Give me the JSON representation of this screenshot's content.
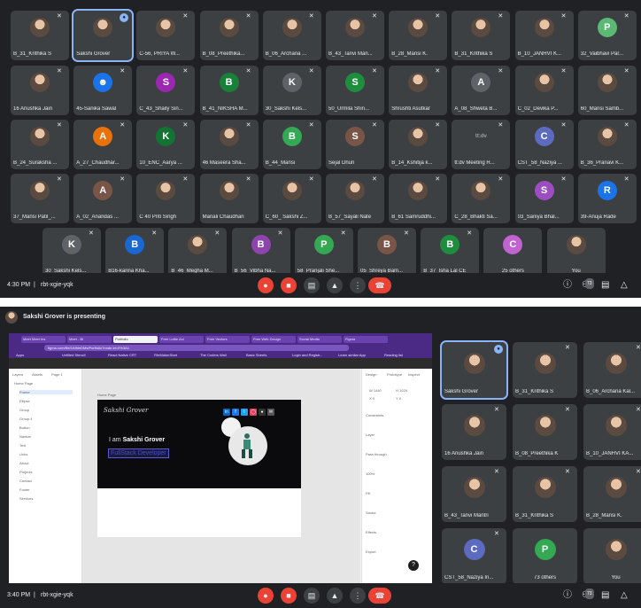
{
  "grid": {
    "tiles": [
      {
        "name": "B_31_Krithika S",
        "initial": "",
        "color": "#7b1f2e",
        "photo": true
      },
      {
        "name": "Sakshi Grover",
        "initial": "",
        "color": "#b08868",
        "photo": true
      },
      {
        "name": "C-56, PRIYA W...",
        "initial": "",
        "color": "#d9cbb8",
        "photo": true
      },
      {
        "name": "B_08_Preethika...",
        "initial": "",
        "color": "#cccccc",
        "photo": true
      },
      {
        "name": "B_06_Archana ...",
        "initial": "",
        "color": "#1a1a1a",
        "photo": true
      },
      {
        "name": "B_43_Tanvi Man...",
        "initial": "",
        "color": "#c48a6a",
        "photo": true
      },
      {
        "name": "B_28_Mansi K.",
        "initial": "",
        "color": "#7a5038",
        "photo": true
      },
      {
        "name": "B_31_Krithika S",
        "initial": "",
        "color": "#7b1f2e",
        "photo": true
      },
      {
        "name": "B_10_JANHVI K...",
        "initial": "",
        "color": "#6a5040",
        "photo": true
      },
      {
        "name": "32_Vaibhavi Par...",
        "initial": "P",
        "color": "#5bb974",
        "photo": false
      },
      {
        "name": "16 Anushka Jain",
        "initial": "",
        "color": "#6a4636",
        "photo": true
      },
      {
        "name": "45-Sanika Sawal",
        "initial": "☻",
        "color": "#1a73e8",
        "photo": false
      },
      {
        "name": "C_43_Shaily Sin...",
        "initial": "S",
        "color": "#9c27b0",
        "photo": false
      },
      {
        "name": "B_41_NIKSHA M...",
        "initial": "B",
        "color": "#188038",
        "photo": false
      },
      {
        "name": "30_Sakshi Kels...",
        "initial": "K",
        "color": "#5f6368",
        "photo": false
      },
      {
        "name": "50_Urmila Shin...",
        "initial": "S",
        "color": "#1e8e3e",
        "photo": false
      },
      {
        "name": "Shrushti Asutkar",
        "initial": "",
        "color": "#c0502a",
        "photo": true
      },
      {
        "name": "A_08_Shweta B...",
        "initial": "A",
        "color": "#5f6368",
        "photo": false
      },
      {
        "name": "C_02_Devika P...",
        "initial": "",
        "color": "#a07050",
        "photo": true
      },
      {
        "name": "60_Mansi Samb...",
        "initial": "",
        "color": "#8a4050",
        "photo": true
      },
      {
        "name": "B_24_Suraksha ...",
        "initial": "",
        "color": "#403a36",
        "photo": true
      },
      {
        "name": "A_27_Chaudhar...",
        "initial": "A",
        "color": "#e8710a",
        "photo": false
      },
      {
        "name": "10_ENC_Aarya ...",
        "initial": "K",
        "color": "#137333",
        "photo": false
      },
      {
        "name": "46 Maseera Sha...",
        "initial": "",
        "color": "#8a6a5a",
        "photo": true
      },
      {
        "name": "B_44_Mansi",
        "initial": "B",
        "color": "#34a853",
        "photo": false
      },
      {
        "name": "Sejal Dhuri",
        "initial": "S",
        "color": "#795548",
        "photo": false
      },
      {
        "name": "B_14_Kshitija k...",
        "initial": "",
        "color": "#c08a20",
        "photo": true
      },
      {
        "name": "tt:dv Meeting R...",
        "initial": "tt:dv",
        "color": "#3c4043",
        "photo": false
      },
      {
        "name": "CST_58_Naziya ...",
        "initial": "C",
        "color": "#5c6bc0",
        "photo": false
      },
      {
        "name": "B_36_Pranavi K...",
        "initial": "",
        "color": "#8a8a50",
        "photo": true
      },
      {
        "name": "37_Mansi Patil_...",
        "initial": "",
        "color": "#2040a0",
        "photo": true
      },
      {
        "name": "A_02_Anandas ...",
        "initial": "A",
        "color": "#795548",
        "photo": false
      },
      {
        "name": "C 40 Priti Singh",
        "initial": "",
        "color": "#7a5040",
        "photo": true
      },
      {
        "name": "Manali Chaudhari",
        "initial": "",
        "color": "#c09a70",
        "photo": true
      },
      {
        "name": "C_60_ Sakshi Z...",
        "initial": "",
        "color": "#9a8a7a",
        "photo": true
      },
      {
        "name": "B_57_Sayali Nate",
        "initial": "",
        "color": "#e0e0e0",
        "photo": true
      },
      {
        "name": "B_61 Samruddhi...",
        "initial": "",
        "color": "#b07a5a",
        "photo": true
      },
      {
        "name": "C_28_Bhakti Sa...",
        "initial": "",
        "color": "#a06a50",
        "photo": true
      },
      {
        "name": "03_Saniya Bhal...",
        "initial": "S",
        "color": "#9c4ec0",
        "photo": false
      },
      {
        "name": "39-Anuja Rade",
        "initial": "R",
        "color": "#1a73e8",
        "photo": false
      },
      {
        "name": "30_Sakshi Kels...",
        "initial": "K",
        "color": "#5f6368",
        "photo": false
      },
      {
        "name": "B16-karina Kha...",
        "initial": "B",
        "color": "#1967d2",
        "photo": false
      },
      {
        "name": "B_46_Megha M...",
        "initial": "",
        "color": "#9a8070",
        "photo": true
      },
      {
        "name": "B_56_Vibha Na...",
        "initial": "B",
        "color": "#8e44ad",
        "photo": false
      },
      {
        "name": "58_Pranjali She...",
        "initial": "P",
        "color": "#34a853",
        "photo": false
      },
      {
        "name": "05_Shreya Bam...",
        "initial": "B",
        "color": "#795548",
        "photo": false
      },
      {
        "name": "B_37_Isha Lal CE",
        "initial": "B",
        "color": "#1e8e3e",
        "photo": false
      },
      {
        "name": "25 others",
        "initial": "C",
        "color": "#c062d0",
        "photo": false
      },
      {
        "name": "You",
        "initial": "",
        "color": "#8a7a6a",
        "photo": true
      }
    ]
  },
  "bottom1": {
    "time": "4:30 PM",
    "sep": "|",
    "code": "rbt-xgie-yqk",
    "participants": "73"
  },
  "presentation": {
    "title": "Sakshi Grover is presenting",
    "browser": {
      "tabs": [
        "Meet Meet Ins",
        "Meet - Bi",
        "Portfolio",
        "Free Lottie Ani",
        "Free Vectors",
        "Free Web Design",
        "Social Media",
        "Figma"
      ],
      "url": "figma.com/file/1AfhleDMs/Portfolio?node-id=0%3A1",
      "bookmarks": [
        "Apps",
        "Unfilled Stencil",
        "React Native CRT",
        "FileMakerStart",
        "The Coders Wall",
        "Basic Sheets",
        "Login and Registr...",
        "Learn similar App",
        "Reading list"
      ]
    },
    "figma": {
      "layers": [
        "Layers",
        "Assets",
        "Page 1",
        "Home Page",
        "Frame",
        "Ellipse",
        "Group",
        "Group 4",
        "Button",
        "Navbar",
        "Text",
        "Links",
        "About",
        "Projects",
        "Contact",
        "Footer",
        "Services"
      ],
      "props": [
        "Design",
        "Prototype",
        "Inspect",
        "W 1440",
        "H 1024",
        "X 0",
        "Y 0",
        "Constraints",
        "Layer",
        "Pass through",
        "100%",
        "Fill",
        "Stroke",
        "Effects",
        "Export"
      ],
      "signature": "Sakshi Grover",
      "greeting_prefix": "I am",
      "greeting_name": "Sakshi Grover",
      "role": "FullStack Developer",
      "frame_label": "Home Page",
      "fab": "?"
    },
    "tiles": [
      {
        "name": "Sakshi Grover",
        "initial": "",
        "color": "#b08868",
        "photo": true
      },
      {
        "name": "B_31_Krithika S",
        "initial": "",
        "color": "#7b1f2e",
        "photo": true
      },
      {
        "name": "B_06_Archana Kal...",
        "initial": "",
        "color": "#1a1a1a",
        "photo": true
      },
      {
        "name": "16 Anushka Jain",
        "initial": "",
        "color": "#6a4636",
        "photo": true
      },
      {
        "name": "B_08_Preethika K",
        "initial": "",
        "color": "#cccccc",
        "photo": true
      },
      {
        "name": "B_10_JANHVI KA...",
        "initial": "",
        "color": "#6a5040",
        "photo": true
      },
      {
        "name": "B_43_Tanvi Mantri",
        "initial": "",
        "color": "#c48a6a",
        "photo": true
      },
      {
        "name": "B_31_Krithika S",
        "initial": "",
        "color": "#7b1f2e",
        "photo": true
      },
      {
        "name": "B_28_Mansi K.",
        "initial": "",
        "color": "#7a5038",
        "photo": true
      },
      {
        "name": "CST_58_Naziya In...",
        "initial": "C",
        "color": "#5c6bc0",
        "photo": false
      },
      {
        "name": "73 others",
        "initial": "P",
        "color": "#34a853",
        "photo": false
      },
      {
        "name": "You",
        "initial": "",
        "color": "#8a7a6a",
        "photo": true
      }
    ]
  },
  "bottom2": {
    "time": "3:40 PM",
    "sep": "|",
    "code": "rbt-xgie-yqk",
    "participants": "73"
  },
  "icons": {
    "mic_off": "mic-off-icon",
    "cam_off": "camera-off-icon",
    "cc": "captions-icon",
    "present": "present-icon",
    "more": "more-icon",
    "hangup": "hangup-icon",
    "info": "info-icon",
    "people": "people-icon",
    "chat": "chat-icon",
    "activities": "activities-icon"
  }
}
